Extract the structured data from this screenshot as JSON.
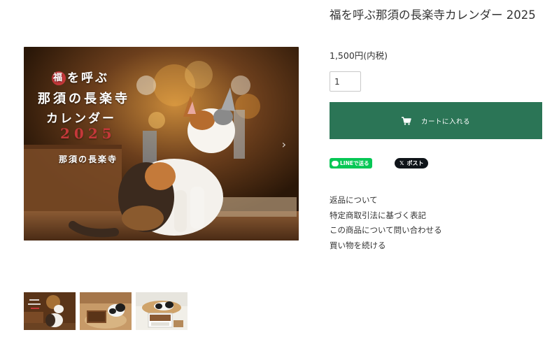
{
  "product": {
    "title": "福を呼ぶ那須の長楽寺カレンダー 2025",
    "price": "1,500円(内税)",
    "quantity": "1"
  },
  "cover": {
    "line1_mark": "福",
    "line1_rest": "を呼ぶ",
    "line2": "那須の長楽寺",
    "line3": "カレンダー",
    "year": "2025",
    "subtitle": "那須の長楽寺"
  },
  "cart_button": {
    "label": "カートに入れる",
    "icon": "cart-icon",
    "color": "#2b7556"
  },
  "share": {
    "line_label": "LINEで送る",
    "line_color": "#06c755",
    "x_glyph": "𝕏",
    "x_label": "ポスト"
  },
  "links": [
    "返品について",
    "特定商取引法に基づく表記",
    "この商品について問い合わせる",
    "買い物を続ける"
  ]
}
